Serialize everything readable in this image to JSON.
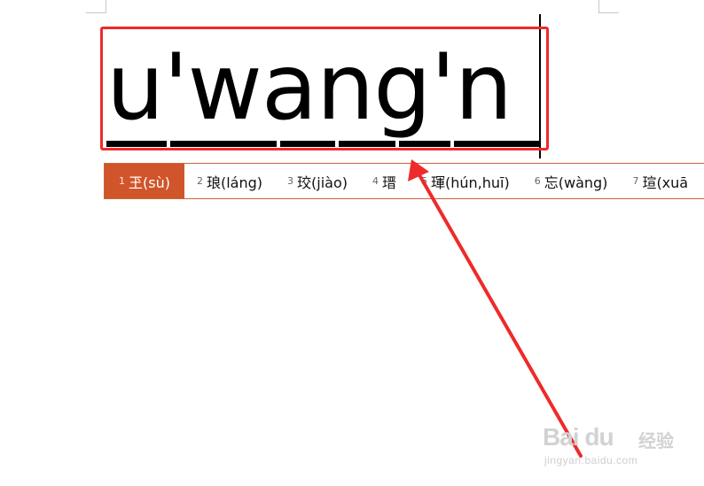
{
  "composition": {
    "text": "u'wang'n"
  },
  "candidates": [
    {
      "num": "1",
      "text": "玊(sù)",
      "selected": true
    },
    {
      "num": "2",
      "text": "琅(láng)"
    },
    {
      "num": "3",
      "text": "珓(jiào)"
    },
    {
      "num": "4",
      "text": "瑨"
    },
    {
      "num": "5",
      "text": "琿(hún,huī)"
    },
    {
      "num": "6",
      "text": "忘(wàng)"
    },
    {
      "num": "7",
      "text": "瑄(xuā"
    }
  ],
  "watermark": {
    "brand": "Bai du",
    "sub": "经验",
    "url": "jingyan.baidu.com"
  },
  "colors": {
    "highlight": "#ee2a2a",
    "selected_candidate": "#d1552b",
    "bar_border": "#c9643a"
  }
}
